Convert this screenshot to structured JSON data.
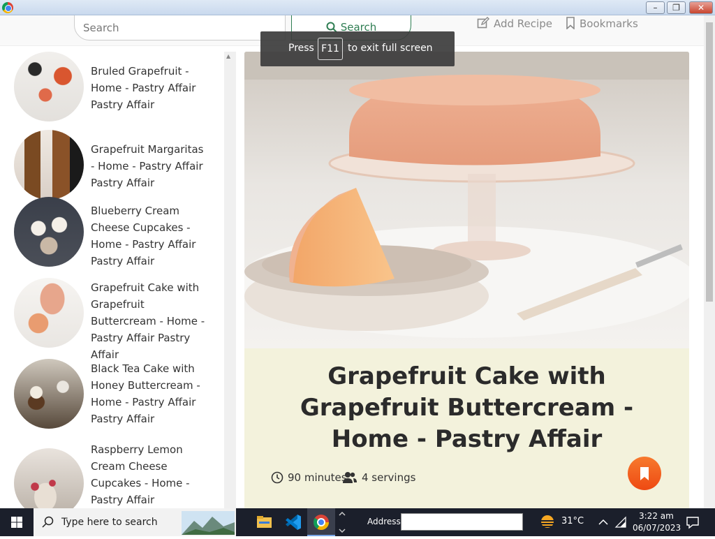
{
  "nav": {
    "search_placeholder": "Search",
    "search_button": "Search",
    "add_recipe": "Add Recipe",
    "bookmarks": "Bookmarks"
  },
  "toast": {
    "pre": "Press",
    "key": "F11",
    "post": "to exit full screen"
  },
  "sidebar": {
    "items": [
      {
        "label": "Bruled Grapefruit - Home - Pastry Affair Pastry Affair"
      },
      {
        "label": "Grapefruit Margaritas - Home - Pastry Affair Pastry Affair"
      },
      {
        "label": "Blueberry Cream Cheese Cupcakes - Home - Pastry Affair Pastry Affair"
      },
      {
        "label": "Grapefruit Cake with Grapefruit Buttercream - Home - Pastry Affair Pastry Affair"
      },
      {
        "label": "Black Tea Cake with Honey Buttercream - Home - Pastry Affair Pastry Affair"
      },
      {
        "label": "Raspberry Lemon Cream Cheese Cupcakes - Home - Pastry Affair"
      }
    ]
  },
  "recipe": {
    "title": "Grapefruit Cake with Grapefruit Buttercream - Home - Pastry Affair",
    "duration": "90 minutes",
    "servings": "4 servings"
  },
  "taskbar": {
    "search_label": "Type here to search",
    "address_label": "Address",
    "temperature": "31°C",
    "time": "3:22 am",
    "date": "06/07/2023"
  },
  "colors": {
    "accent_green": "#2e7d52",
    "fab_orange": "#f26522",
    "info_bg": "#f3f2dc",
    "taskbar_bg": "#1b1f2b"
  },
  "icons": [
    "chrome-icon",
    "search-icon",
    "edit-icon",
    "bookmark-icon",
    "clock-icon",
    "users-icon",
    "windows-icon",
    "file-explorer-icon",
    "vscode-icon",
    "weather-icon",
    "network-icon",
    "notification-icon"
  ]
}
